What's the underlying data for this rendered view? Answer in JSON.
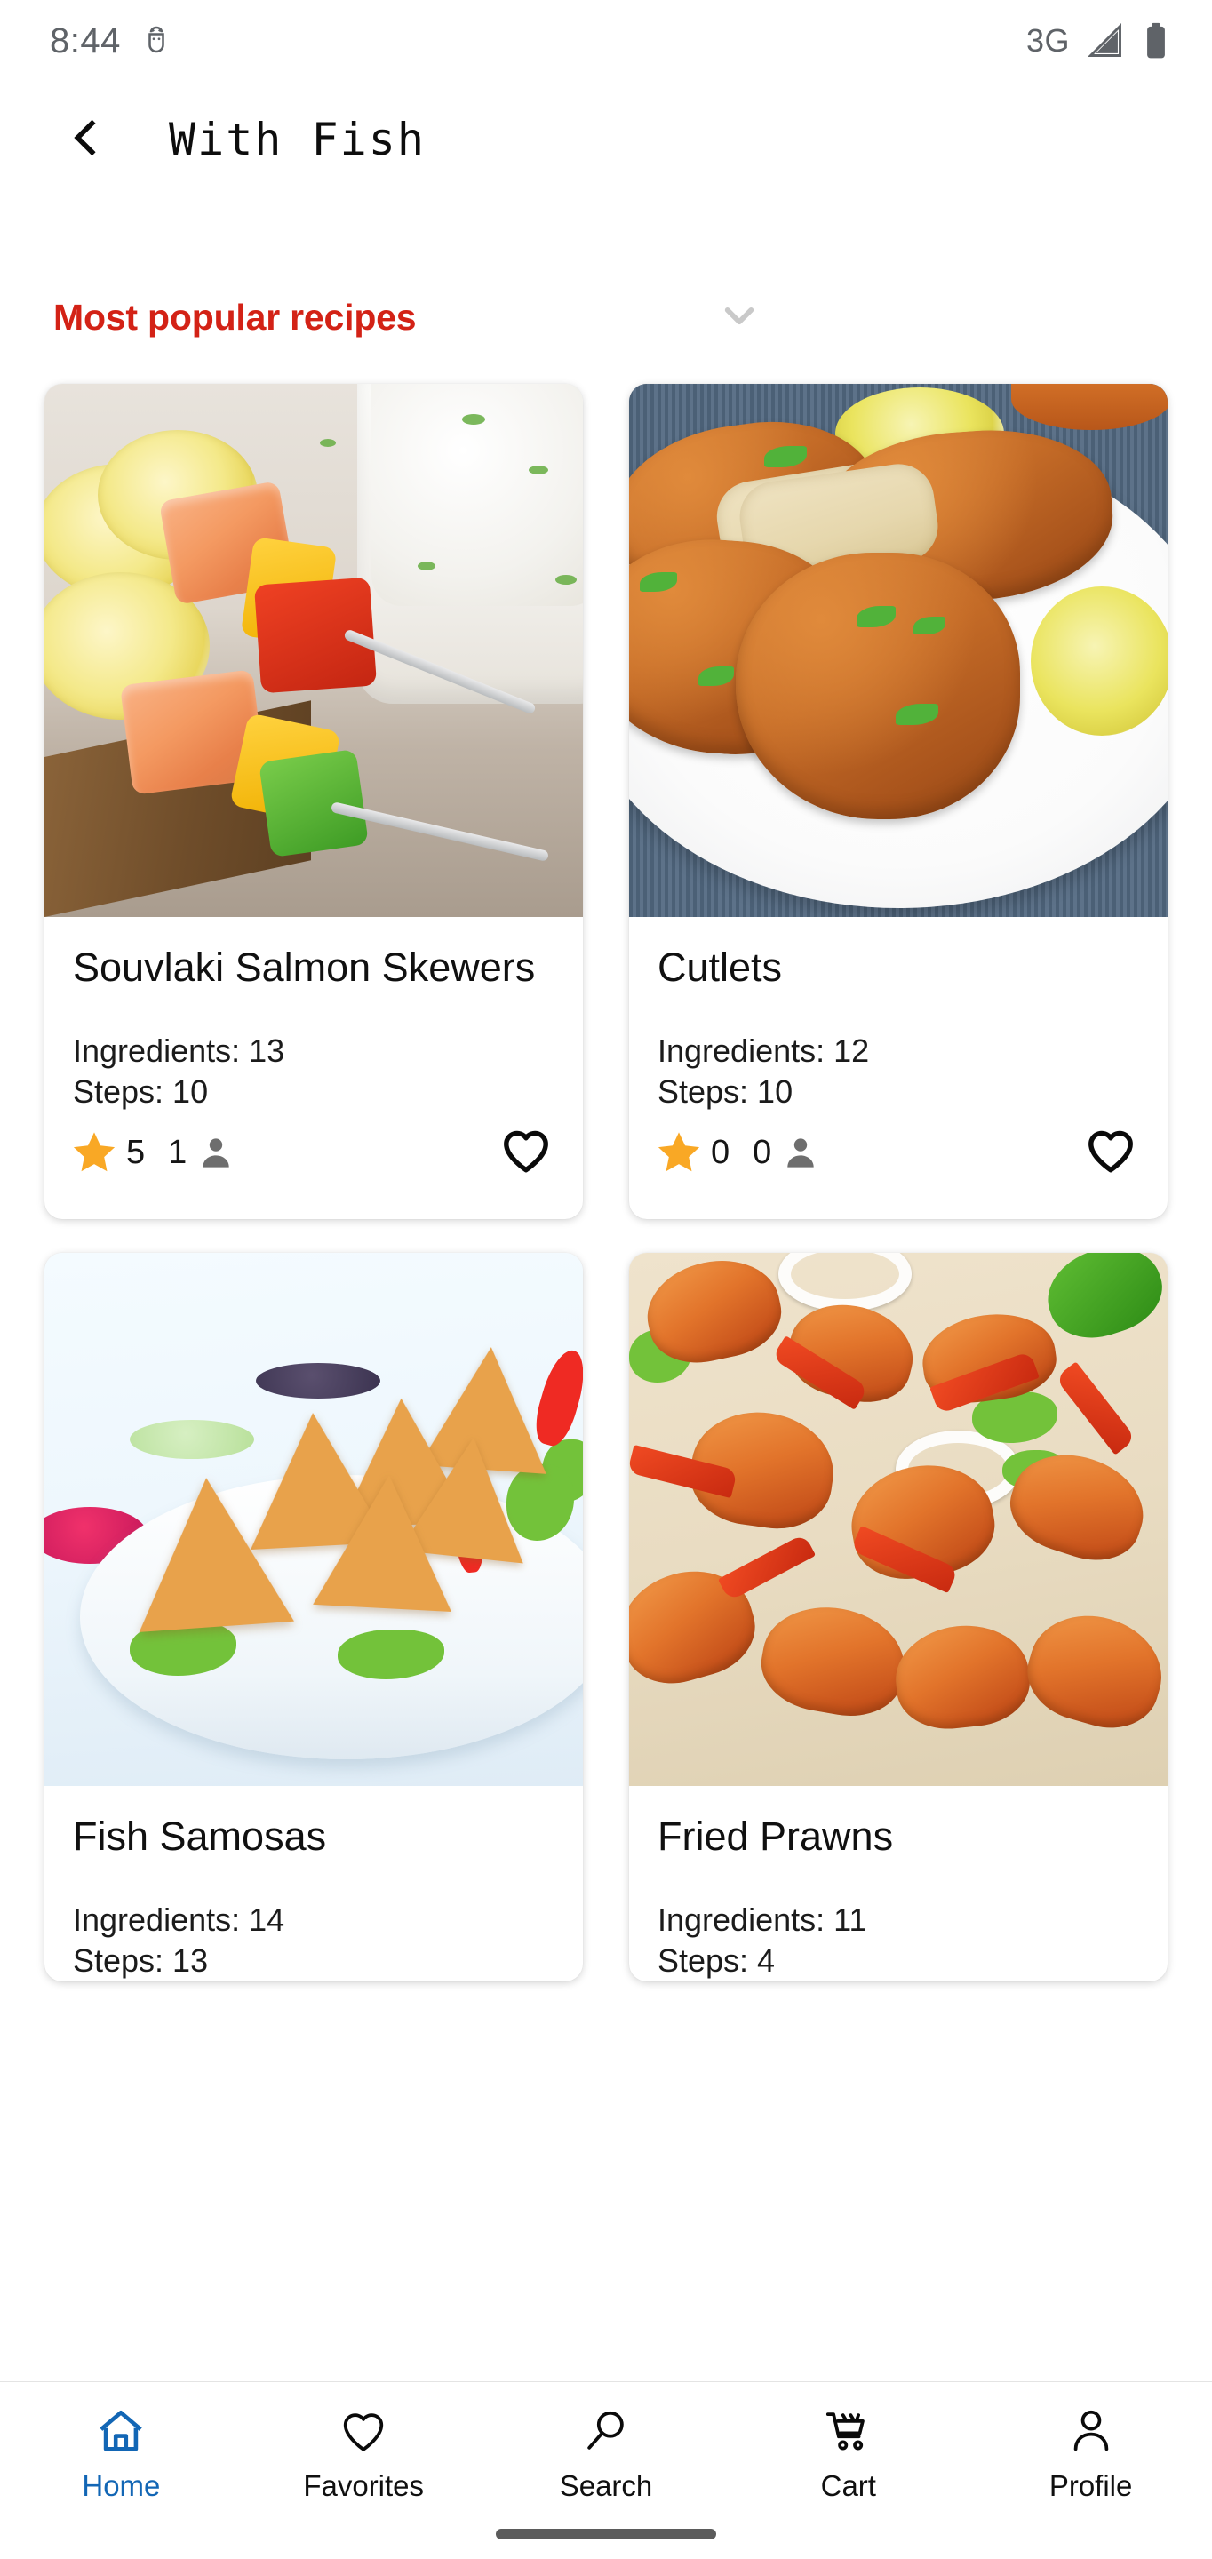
{
  "status_bar": {
    "time": "8:44",
    "debug_icon": "android-bug-icon",
    "network_type": "3G",
    "signal_icon": "signal-bars-icon",
    "battery_icon": "battery-full-icon"
  },
  "app_bar": {
    "back_icon": "chevron-left-icon",
    "title": "With Fish"
  },
  "filter": {
    "label": "Most popular recipes",
    "label_color": "#D32216",
    "chevron_icon": "chevron-down-icon"
  },
  "recipes": [
    {
      "title": "Souvlaki Salmon Skewers",
      "ingredients_label": "Ingredients: 13",
      "steps_label": "Steps: 10",
      "rating": "5",
      "reviews": "1",
      "star_icon": "star-filled-icon",
      "person_icon": "person-icon",
      "favorite_icon": "heart-outline-icon",
      "image_alt": "salmon-skewers-photo"
    },
    {
      "title": "Cutlets",
      "ingredients_label": "Ingredients: 12",
      "steps_label": "Steps: 10",
      "rating": "0",
      "reviews": "0",
      "star_icon": "star-filled-icon",
      "person_icon": "person-icon",
      "favorite_icon": "heart-outline-icon",
      "image_alt": "cutlets-photo"
    },
    {
      "title": "Fish Samosas",
      "ingredients_label": "Ingredients: 14",
      "steps_label": "Steps: 13",
      "rating": "",
      "reviews": "",
      "star_icon": "star-filled-icon",
      "person_icon": "person-icon",
      "favorite_icon": "heart-outline-icon",
      "image_alt": "fish-samosas-photo"
    },
    {
      "title": "Fried Prawns",
      "ingredients_label": "Ingredients: 11",
      "steps_label": "Steps: 4",
      "rating": "",
      "reviews": "",
      "star_icon": "star-filled-icon",
      "person_icon": "person-icon",
      "favorite_icon": "heart-outline-icon",
      "image_alt": "fried-prawns-photo"
    }
  ],
  "bottom_nav": {
    "active_color": "#1266B5",
    "items": [
      {
        "label": "Home",
        "icon": "home-icon",
        "active": true
      },
      {
        "label": "Favorites",
        "icon": "heart-outline-icon",
        "active": false
      },
      {
        "label": "Search",
        "icon": "search-icon",
        "active": false
      },
      {
        "label": "Cart",
        "icon": "cart-icon",
        "active": false
      },
      {
        "label": "Profile",
        "icon": "person-outline-icon",
        "active": false
      }
    ]
  },
  "star_color": "#F9A825"
}
